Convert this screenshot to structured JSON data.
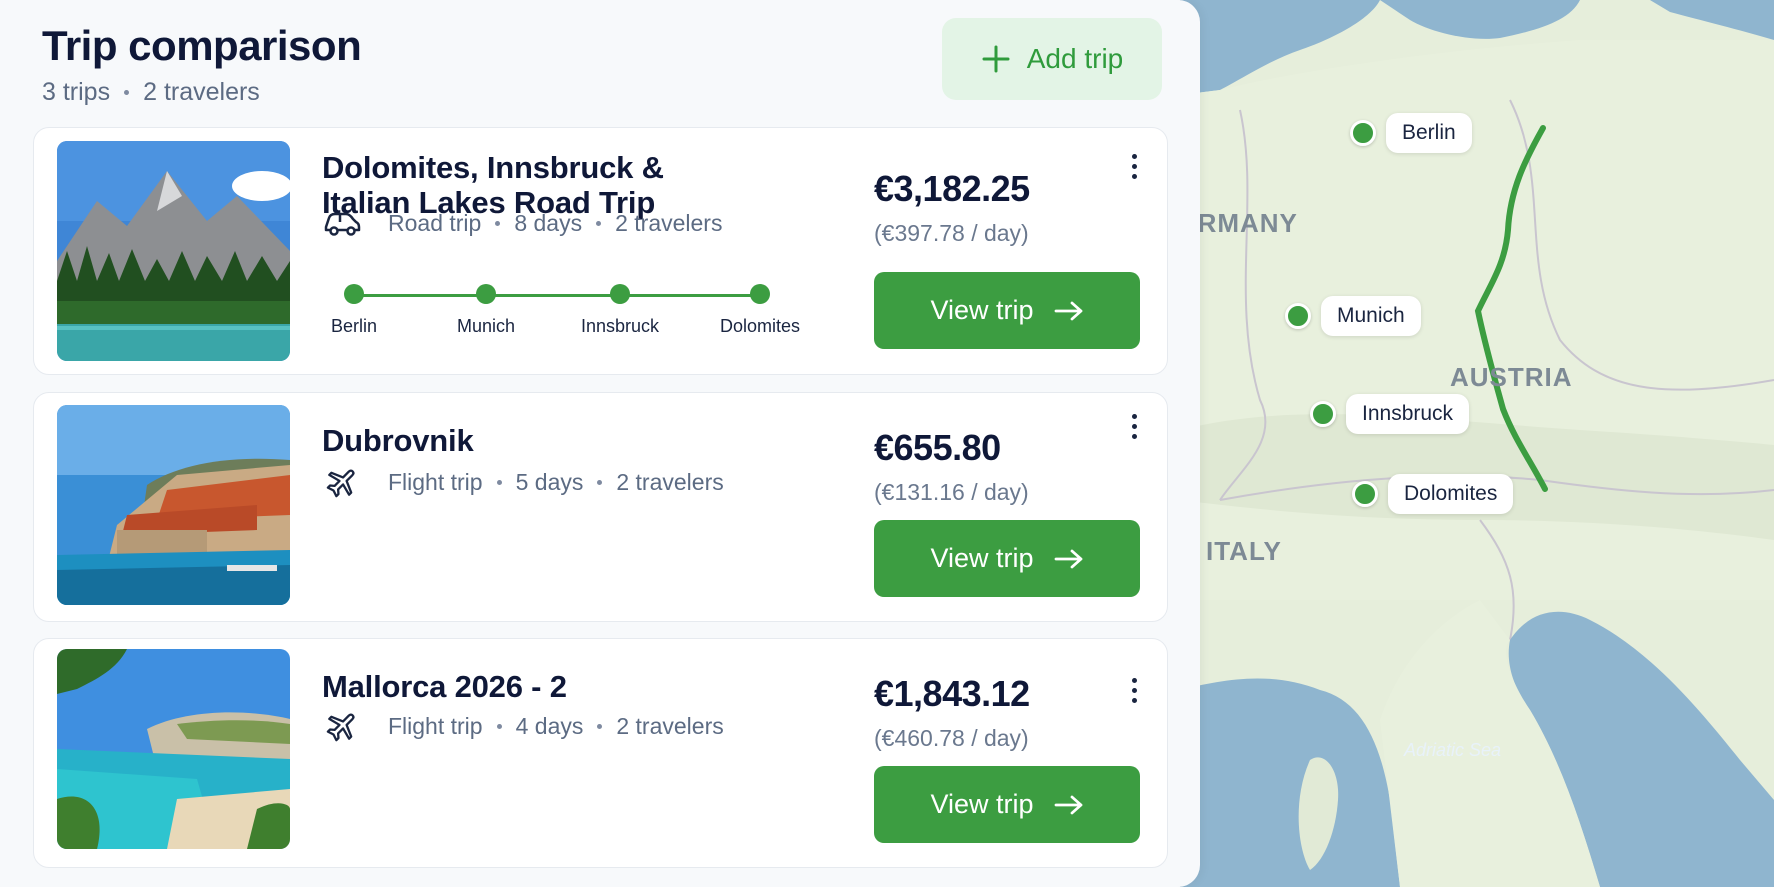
{
  "header": {
    "title": "Trip comparison",
    "trips_count": "3 trips",
    "travelers_count": "2 travelers",
    "add_trip_label": "Add trip"
  },
  "trips": [
    {
      "title_line1": "Dolomites, Innsbruck &",
      "title_line2": "Italian Lakes Road Trip",
      "type": "Road trip",
      "days": "8 days",
      "travelers": "2 travelers",
      "price": "€3,182.25",
      "per_day": "(€397.78 / day)",
      "view_label": "View trip",
      "stops": [
        "Berlin",
        "Munich",
        "Innsbruck",
        "Dolomites"
      ]
    },
    {
      "title_line1": "Dubrovnik",
      "type": "Flight trip",
      "days": "5 days",
      "travelers": "2 travelers",
      "price": "€655.80",
      "per_day": "(€131.16 / day)",
      "view_label": "View trip"
    },
    {
      "title_line1": "Mallorca 2026 - 2",
      "type": "Flight trip",
      "days": "4 days",
      "travelers": "2 travelers",
      "price": "€1,843.12",
      "per_day": "(€460.78 / day)",
      "view_label": "View trip"
    }
  ],
  "map": {
    "countries": [
      "GERMANY",
      "AUSTRIA",
      "ITALY"
    ],
    "sea": "Adriatic Sea",
    "cities": [
      "Berlin",
      "Munich",
      "Innsbruck",
      "Dolomites"
    ]
  },
  "colors": {
    "accent": "#3c9d41",
    "accent_soft": "#e3f4e6",
    "text": "#0f1838",
    "muted": "#5c6b83"
  }
}
